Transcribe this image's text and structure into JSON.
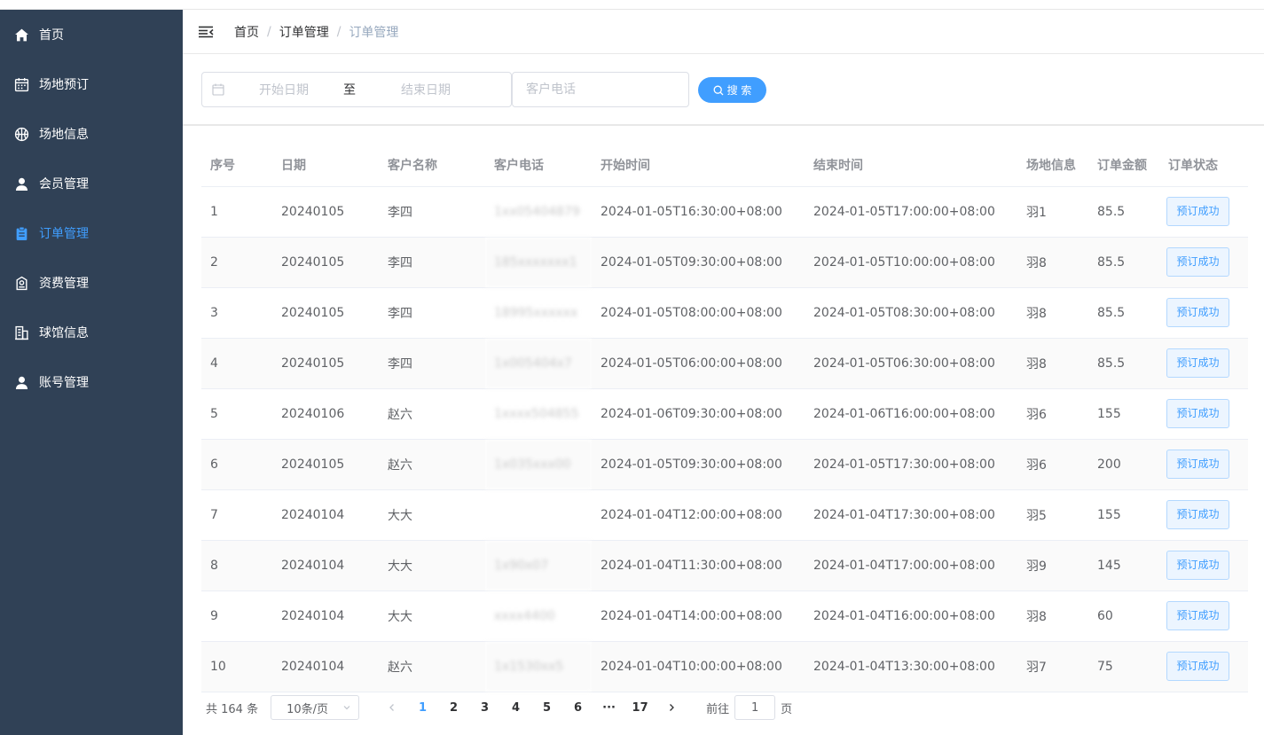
{
  "sidebar": {
    "items": [
      {
        "label": "首页",
        "icon": "home-icon"
      },
      {
        "label": "场地预订",
        "icon": "calendar-icon"
      },
      {
        "label": "场地信息",
        "icon": "basketball-icon"
      },
      {
        "label": "会员管理",
        "icon": "user-icon"
      },
      {
        "label": "订单管理",
        "icon": "clipboard-icon",
        "active": true
      },
      {
        "label": "资费管理",
        "icon": "tariff-icon"
      },
      {
        "label": "球馆信息",
        "icon": "building-icon"
      },
      {
        "label": "账号管理",
        "icon": "user-icon"
      }
    ],
    "bg_color": "#304156",
    "active_color": "#409eff"
  },
  "breadcrumb": [
    "首页",
    "订单管理",
    "订单管理"
  ],
  "search": {
    "start_placeholder": "开始日期",
    "range_separator": "至",
    "end_placeholder": "结束日期",
    "phone_placeholder": "客户电话",
    "button_label": "搜 索"
  },
  "table": {
    "headers": [
      "序号",
      "日期",
      "客户名称",
      "客户电话",
      "开始时间",
      "结束时间",
      "场地信息",
      "订单金额",
      "订单状态"
    ],
    "rows": [
      {
        "no": "1",
        "date": "20240105",
        "name": "李四",
        "phone": "1xx05404879",
        "start": "2024-01-05T16:30:00+08:00",
        "end": "2024-01-05T17:00:00+08:00",
        "court": "羽1",
        "amount": "85.5",
        "status": "预订成功"
      },
      {
        "no": "2",
        "date": "20240105",
        "name": "李四",
        "phone": "185xxxxxxx1",
        "start": "2024-01-05T09:30:00+08:00",
        "end": "2024-01-05T10:00:00+08:00",
        "court": "羽8",
        "amount": "85.5",
        "status": "预订成功"
      },
      {
        "no": "3",
        "date": "20240105",
        "name": "李四",
        "phone": "18995xxxxxx",
        "start": "2024-01-05T08:00:00+08:00",
        "end": "2024-01-05T08:30:00+08:00",
        "court": "羽8",
        "amount": "85.5",
        "status": "预订成功"
      },
      {
        "no": "4",
        "date": "20240105",
        "name": "李四",
        "phone": "1x005404x7",
        "start": "2024-01-05T06:00:00+08:00",
        "end": "2024-01-05T06:30:00+08:00",
        "court": "羽8",
        "amount": "85.5",
        "status": "预订成功"
      },
      {
        "no": "5",
        "date": "20240106",
        "name": "赵六",
        "phone": "1xxxx504855",
        "start": "2024-01-06T09:30:00+08:00",
        "end": "2024-01-06T16:00:00+08:00",
        "court": "羽6",
        "amount": "155",
        "status": "预订成功"
      },
      {
        "no": "6",
        "date": "20240105",
        "name": "赵六",
        "phone": "1x035xxx00",
        "start": "2024-01-05T09:30:00+08:00",
        "end": "2024-01-05T17:30:00+08:00",
        "court": "羽6",
        "amount": "200",
        "status": "预订成功"
      },
      {
        "no": "7",
        "date": "20240104",
        "name": "大大",
        "phone": "",
        "start": "2024-01-04T12:00:00+08:00",
        "end": "2024-01-04T17:30:00+08:00",
        "court": "羽5",
        "amount": "155",
        "status": "预订成功"
      },
      {
        "no": "8",
        "date": "20240104",
        "name": "大大",
        "phone": "1x90x07",
        "start": "2024-01-04T11:30:00+08:00",
        "end": "2024-01-04T17:00:00+08:00",
        "court": "羽9",
        "amount": "145",
        "status": "预订成功"
      },
      {
        "no": "9",
        "date": "20240104",
        "name": "大大",
        "phone": "xxxx4400",
        "start": "2024-01-04T14:00:00+08:00",
        "end": "2024-01-04T16:00:00+08:00",
        "court": "羽8",
        "amount": "60",
        "status": "预订成功"
      },
      {
        "no": "10",
        "date": "20240104",
        "name": "赵六",
        "phone": "1x1530xx5",
        "start": "2024-01-04T10:00:00+08:00",
        "end": "2024-01-04T13:30:00+08:00",
        "court": "羽7",
        "amount": "75",
        "status": "预订成功"
      }
    ]
  },
  "pagination": {
    "total_text": "共 164 条",
    "page_size": "10条/页",
    "pages": [
      "1",
      "2",
      "3",
      "4",
      "5",
      "6",
      "···",
      "17"
    ],
    "current": "1",
    "goto_prefix": "前往",
    "goto_value": "1",
    "goto_suffix": "页"
  }
}
